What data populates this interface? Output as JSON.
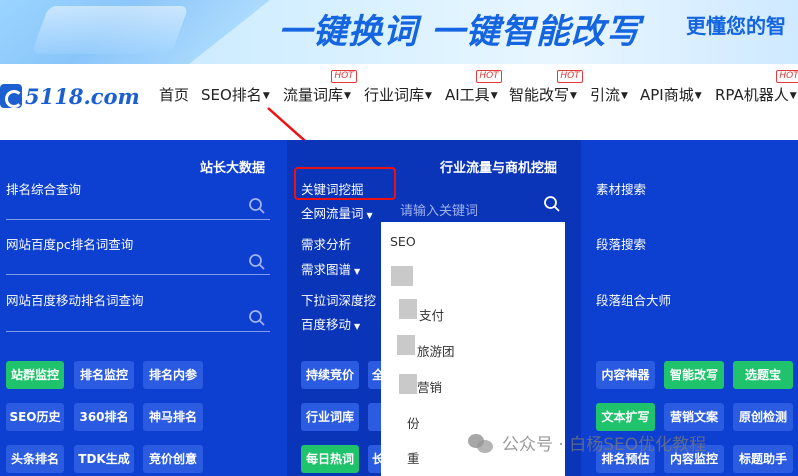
{
  "banner": {
    "title": "一键换词 一键智能改写",
    "subtitle": "更懂您的智"
  },
  "logo": {
    "text": "5118.com"
  },
  "nav": {
    "items": [
      "首页",
      "SEO排名",
      "流量词库",
      "行业词库",
      "AI工具",
      "智能改写",
      "引流",
      "API商城",
      "RPA机器人"
    ],
    "hot_label": "HOT"
  },
  "left": {
    "header": "站长大数据",
    "queries": [
      "排名综合查询",
      "网站百度pc排名词查询",
      "网站百度移动排名词查询"
    ],
    "buttons": [
      "站群监控",
      "排名监控",
      "排名内参",
      "SEO历史",
      "360排名",
      "神马排名",
      "头条排名",
      "TDK生成",
      "竞价创意"
    ]
  },
  "middle": {
    "header": "行业流量与商机挖掘",
    "kw_mining": "关键词挖掘",
    "scope": "全网流量词",
    "input_placeholder": "请输入关键词",
    "demand": "需求分析",
    "demand_map": "需求图谱",
    "dropdown_dig": "下拉词深度挖",
    "baidu_mobile": "百度移动",
    "buttons": [
      "持续竞价",
      "全",
      "行业词库",
      "每日热词",
      "长"
    ]
  },
  "suggestions": [
    "SEO",
    "",
    "支付",
    "旅游团",
    "营销",
    "份",
    "重"
  ],
  "right": {
    "queries": [
      "素材搜索",
      "段落搜索",
      "段落组合大师"
    ],
    "buttons": [
      "内容神器",
      "智能改写",
      "选题宝",
      "文本扩写",
      "营销文案",
      "原创检测",
      "排名预估",
      "内容监控",
      "标题助手"
    ]
  },
  "watermark": "公众号 · 白杨SEO优化教程",
  "colors": {
    "panel": "#0d3fd1",
    "panel_mid": "#0a35b8",
    "green": "#1fc36b",
    "accent_red": "#e11111"
  }
}
